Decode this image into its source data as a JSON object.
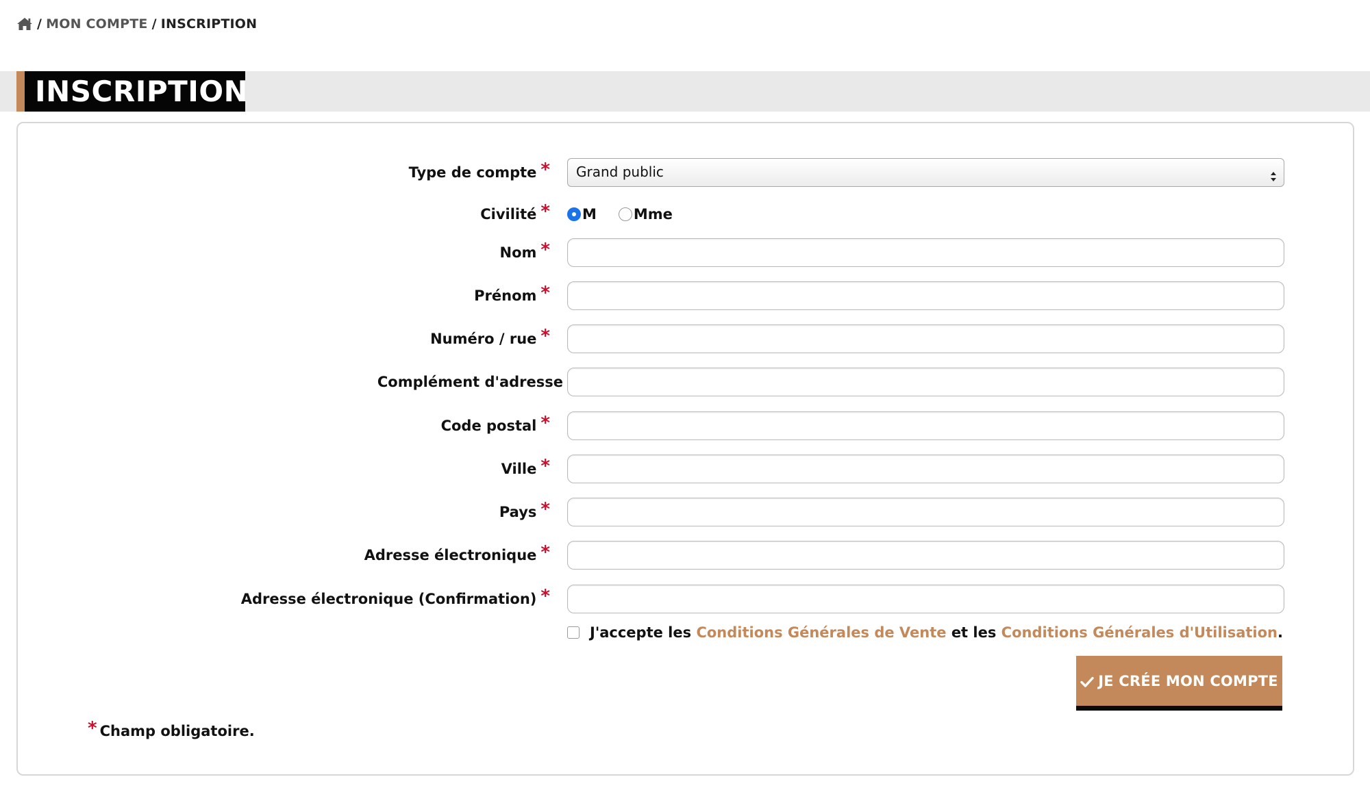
{
  "breadcrumb": {
    "separator": "/",
    "items": [
      "MON COMPTE",
      "INSCRIPTION"
    ]
  },
  "page_title": "INSCRIPTION",
  "form": {
    "required_marker": "*",
    "account_type": {
      "label": "Type de compte",
      "value": "Grand public",
      "required": true
    },
    "civility": {
      "label": "Civilité",
      "required": true,
      "options": [
        {
          "label": "M",
          "checked": true
        },
        {
          "label": "Mme",
          "checked": false
        }
      ]
    },
    "fields": [
      {
        "label": "Nom",
        "value": "",
        "required": true
      },
      {
        "label": "Prénom",
        "value": "",
        "required": true
      },
      {
        "label": "Numéro / rue",
        "value": "",
        "required": true
      },
      {
        "label": "Complément d'adresse",
        "value": "",
        "required": false
      },
      {
        "label": "Code postal",
        "value": "",
        "required": true
      },
      {
        "label": "Ville",
        "value": "",
        "required": true
      },
      {
        "label": "Pays",
        "value": "",
        "required": true
      },
      {
        "label": "Adresse électronique",
        "value": "",
        "required": true
      },
      {
        "label": "Adresse électronique (Confirmation)",
        "value": "",
        "required": true
      }
    ],
    "terms": {
      "checked": false,
      "prefix": "J'accepte les",
      "cgv_link": "Conditions Générales de Vente",
      "middle": "et les",
      "cgu_link": "Conditions Générales d'Utilisation",
      "suffix": "."
    },
    "submit_label": "JE CRÉE MON COMPTE",
    "required_note": "Champ obligatoire."
  },
  "colors": {
    "accent": "#c3895a",
    "required": "#c8102e",
    "title_bg": "#050505",
    "radio_checked": "#1a73e8"
  },
  "icons": {
    "breadcrumb_home": "home-icon",
    "submit": "check-icon",
    "select": "select-arrows-icon"
  }
}
